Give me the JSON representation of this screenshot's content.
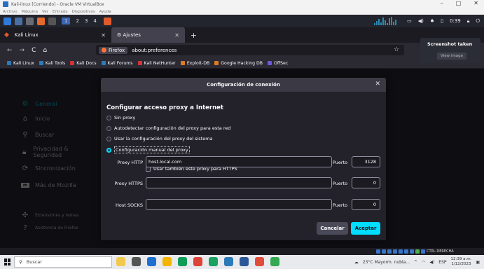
{
  "vbox": {
    "window_title": "Kali-linux [Corriendo] - Oracle VM VirtualBox",
    "menu": [
      "Archivo",
      "Máquina",
      "Ver",
      "Entrada",
      "Dispositivos",
      "Ayuda"
    ],
    "status_host_key": "CTRL DERECHA"
  },
  "kali_panel": {
    "workspaces": [
      "1",
      "2",
      "3",
      "4"
    ],
    "time": "0:39"
  },
  "tabs": [
    {
      "label": "Kali Linux"
    },
    {
      "label": "Ajustes"
    }
  ],
  "navbar": {
    "chip_label": "Firefox",
    "url": "about:preferences"
  },
  "bookmarks": [
    {
      "label": "Kali Linux",
      "color": "#2d7ab9"
    },
    {
      "label": "Kali Tools",
      "color": "#2d7ab9"
    },
    {
      "label": "Kali Docs",
      "color": "#d13438"
    },
    {
      "label": "Kali Forums",
      "color": "#2d7ab9"
    },
    {
      "label": "Kali NetHunter",
      "color": "#d13438"
    },
    {
      "label": "Exploit-DB",
      "color": "#e07a1f"
    },
    {
      "label": "Google Hacking DB",
      "color": "#e07a1f"
    },
    {
      "label": "OffSec",
      "color": "#6b5bd6"
    }
  ],
  "sidebar": {
    "items": [
      {
        "label": "General",
        "icon": "gear-icon"
      },
      {
        "label": "Inicio",
        "icon": "home-icon"
      },
      {
        "label": "Buscar",
        "icon": "search-icon"
      },
      {
        "label": "Privacidad & Seguridad",
        "icon": "lock-icon"
      },
      {
        "label": "Sincronización",
        "icon": "sync-icon"
      },
      {
        "label": "Más de Mozilla",
        "icon": "mozilla-icon"
      },
      {
        "label": "Extensiones y temas",
        "icon": "puzzle-icon"
      },
      {
        "label": "Asistencia de Firefox",
        "icon": "help-icon"
      }
    ]
  },
  "dialog": {
    "title": "Configuración de conexión",
    "section_title": "Configurar acceso proxy a Internet",
    "options": [
      "Sin proxy",
      "Autodetectar configuración del proxy para esta red",
      "Usar la configuración del proxy del sistema",
      "Configuración manual del proxy"
    ],
    "selected_option": 3,
    "http_label": "Proxy HTTP",
    "http_value": "host.local.com",
    "port_label": "Puerto",
    "http_port": "3128",
    "https_checkbox": "Usar también este proxy para HTTPS",
    "https_label": "Proxy HTTPS",
    "https_value": "",
    "https_port": "0",
    "socks_label": "Host SOCKS",
    "socks_value": "",
    "socks_port": "0",
    "cancel": "Cancelar",
    "accept": "Aceptar"
  },
  "toast": {
    "title": "Screenshot taken",
    "button": "View image"
  },
  "taskbar": {
    "search_placeholder": "Buscar",
    "weather": "23°C  Mayorm. nubla...",
    "lang": "ESP",
    "clock_time": "12:39 a.m.",
    "clock_date": "1/12/2023"
  }
}
